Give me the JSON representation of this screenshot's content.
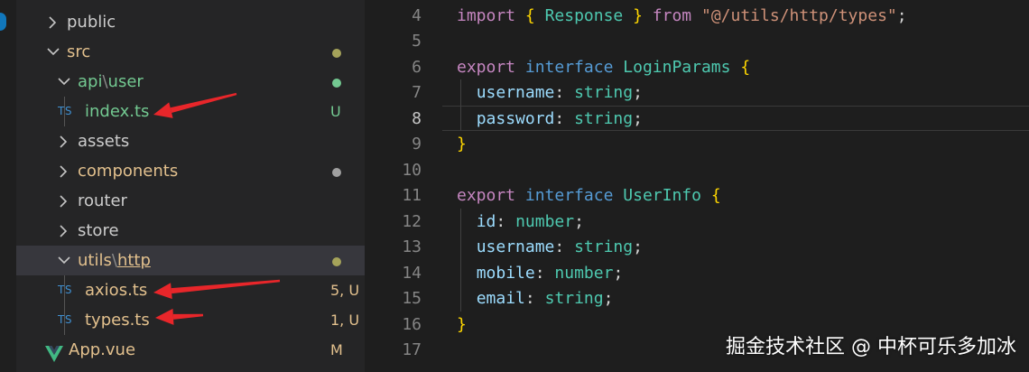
{
  "explorer": {
    "items": [
      {
        "name": "public",
        "kind": "folder",
        "open": false,
        "depth": 0
      },
      {
        "name": "src",
        "kind": "folder",
        "open": true,
        "depth": 0,
        "dot": "#a5a35a"
      },
      {
        "name_parts": [
          "api",
          "user"
        ],
        "kind": "folder",
        "open": true,
        "depth": 1,
        "dot": "#73c991"
      },
      {
        "name": "index.ts",
        "kind": "ts",
        "depth": 2,
        "icon_text": "TS",
        "badge": "U"
      },
      {
        "name": "assets",
        "kind": "folder",
        "open": false,
        "depth": 1
      },
      {
        "name": "components",
        "kind": "folder",
        "open": false,
        "depth": 1,
        "dot": "#a0a0a0"
      },
      {
        "name": "router",
        "kind": "folder",
        "open": false,
        "depth": 1
      },
      {
        "name": "store",
        "kind": "folder",
        "open": false,
        "depth": 1
      },
      {
        "name_parts": [
          "utils",
          "http"
        ],
        "kind": "folder",
        "open": true,
        "depth": 1,
        "dot": "#a5a35a",
        "selected": true
      },
      {
        "name": "axios.ts",
        "kind": "ts",
        "depth": 2,
        "icon_text": "TS",
        "badge": "5, U"
      },
      {
        "name": "types.ts",
        "kind": "ts",
        "depth": 2,
        "icon_text": "TS",
        "badge": "1, U"
      },
      {
        "name": "App.vue",
        "kind": "vue",
        "depth": 1,
        "badge": "M"
      }
    ]
  },
  "editor": {
    "active_line": 8,
    "lines": [
      {
        "n": "4",
        "tokens": [
          [
            "kw",
            "import"
          ],
          [
            "punc",
            " "
          ],
          [
            "brace",
            "{"
          ],
          [
            "punc",
            " "
          ],
          [
            "type",
            "Response"
          ],
          [
            "punc",
            " "
          ],
          [
            "brace",
            "}"
          ],
          [
            "punc",
            " "
          ],
          [
            "kw",
            "from"
          ],
          [
            "punc",
            " "
          ],
          [
            "str",
            "\"@/utils/http/types\""
          ],
          [
            "punc",
            ";"
          ]
        ]
      },
      {
        "n": "5",
        "tokens": []
      },
      {
        "n": "6",
        "tokens": [
          [
            "kw",
            "export"
          ],
          [
            "punc",
            " "
          ],
          [
            "kw2",
            "interface"
          ],
          [
            "punc",
            " "
          ],
          [
            "type",
            "LoginParams"
          ],
          [
            "punc",
            " "
          ],
          [
            "brace",
            "{"
          ]
        ]
      },
      {
        "n": "7",
        "tokens": [
          [
            "punc",
            "  "
          ],
          [
            "prop",
            "username"
          ],
          [
            "punc",
            ": "
          ],
          [
            "type",
            "string"
          ],
          [
            "punc",
            ";"
          ]
        ]
      },
      {
        "n": "8",
        "tokens": [
          [
            "punc",
            "  "
          ],
          [
            "prop",
            "password"
          ],
          [
            "punc",
            ": "
          ],
          [
            "type",
            "string"
          ],
          [
            "punc",
            ";"
          ]
        ]
      },
      {
        "n": "9",
        "tokens": [
          [
            "brace",
            "}"
          ]
        ]
      },
      {
        "n": "10",
        "tokens": []
      },
      {
        "n": "11",
        "tokens": [
          [
            "kw",
            "export"
          ],
          [
            "punc",
            " "
          ],
          [
            "kw2",
            "interface"
          ],
          [
            "punc",
            " "
          ],
          [
            "type",
            "UserInfo"
          ],
          [
            "punc",
            " "
          ],
          [
            "brace",
            "{"
          ]
        ]
      },
      {
        "n": "12",
        "tokens": [
          [
            "punc",
            "  "
          ],
          [
            "prop",
            "id"
          ],
          [
            "punc",
            ": "
          ],
          [
            "type",
            "number"
          ],
          [
            "punc",
            ";"
          ]
        ]
      },
      {
        "n": "13",
        "tokens": [
          [
            "punc",
            "  "
          ],
          [
            "prop",
            "username"
          ],
          [
            "punc",
            ": "
          ],
          [
            "type",
            "string"
          ],
          [
            "punc",
            ";"
          ]
        ]
      },
      {
        "n": "14",
        "tokens": [
          [
            "punc",
            "  "
          ],
          [
            "prop",
            "mobile"
          ],
          [
            "punc",
            ": "
          ],
          [
            "type",
            "number"
          ],
          [
            "punc",
            ";"
          ]
        ]
      },
      {
        "n": "15",
        "tokens": [
          [
            "punc",
            "  "
          ],
          [
            "prop",
            "email"
          ],
          [
            "punc",
            ": "
          ],
          [
            "type",
            "string"
          ],
          [
            "punc",
            ";"
          ]
        ]
      },
      {
        "n": "16",
        "tokens": [
          [
            "brace",
            "}"
          ]
        ]
      },
      {
        "n": "17",
        "tokens": []
      }
    ]
  },
  "watermark": "掘金技术社区 @ 中杯可乐多加冰",
  "colors": {
    "annotation_arrow": "#e8262a",
    "sidebar_bg": "#252526",
    "editor_bg": "#1e1e1e",
    "untracked": "#73c991",
    "modified": "#e2c08d"
  }
}
